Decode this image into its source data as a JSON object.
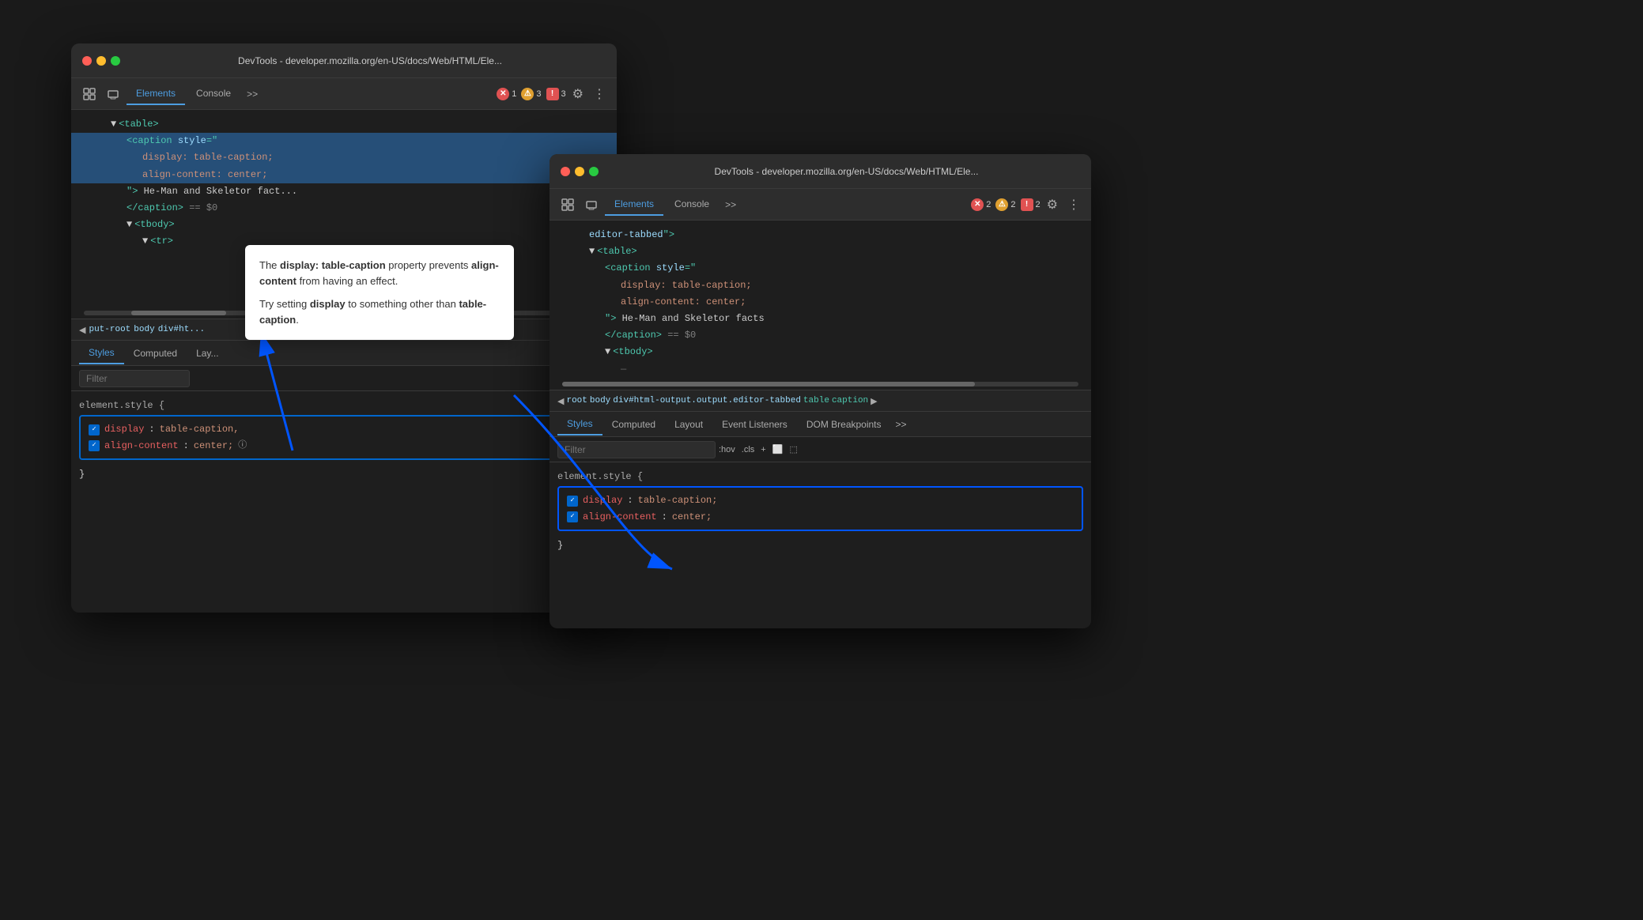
{
  "background": "#1a1a1a",
  "window_back": {
    "title": "DevTools - developer.mozilla.org/en-US/docs/Web/HTML/Ele...",
    "tabs": [
      "Elements",
      "Console"
    ],
    "tab_more": ">>",
    "active_tab": "Elements",
    "badges": [
      {
        "icon": "error",
        "count": "1",
        "type": "error"
      },
      {
        "icon": "warn",
        "count": "3",
        "type": "warn"
      },
      {
        "icon": "info",
        "count": "3",
        "type": "info"
      }
    ],
    "html_lines": [
      {
        "indent": 2,
        "content": "▼<table>",
        "selected": false
      },
      {
        "indent": 3,
        "content": "<caption style=\"",
        "selected": true
      },
      {
        "indent": 4,
        "content": "display: table-caption;",
        "selected": true
      },
      {
        "indent": 4,
        "content": "align-content: center;",
        "selected": true
      },
      {
        "indent": 3,
        "content": "\"> He-Man and Skeletor fact...",
        "selected": false
      },
      {
        "indent": 3,
        "content": "</caption> == $0",
        "selected": false
      },
      {
        "indent": 3,
        "content": "▼<tbody>",
        "selected": false
      },
      {
        "indent": 4,
        "content": "▼<tr>",
        "selected": false
      }
    ],
    "breadcrumb": [
      "◀",
      "put-root",
      "body",
      "div#ht..."
    ],
    "sub_tabs": [
      "Styles",
      "Computed",
      "Lay..."
    ],
    "active_sub_tab": "Styles",
    "filter_placeholder": "Filter",
    "css_rule": {
      "label": "element.style {",
      "props": [
        {
          "checked": true,
          "name": "display",
          "value": "table-caption,"
        },
        {
          "checked": true,
          "name": "align-content",
          "value": "center;",
          "has_info": true
        }
      ],
      "close": "}"
    }
  },
  "window_front": {
    "title": "DevTools - developer.mozilla.org/en-US/docs/Web/HTML/Ele...",
    "tabs": [
      "Elements",
      "Console"
    ],
    "tab_more": ">>",
    "active_tab": "Elements",
    "badges": [
      {
        "icon": "error",
        "count": "2",
        "type": "error"
      },
      {
        "icon": "warn",
        "count": "2",
        "type": "warn"
      },
      {
        "icon": "info",
        "count": "2",
        "type": "info"
      }
    ],
    "html_lines": [
      {
        "indent": 2,
        "content": "editor-tabbed\">",
        "selected": false
      },
      {
        "indent": 2,
        "content": "▼<table>",
        "selected": false
      },
      {
        "indent": 3,
        "content": "<caption style=\"",
        "selected": false
      },
      {
        "indent": 4,
        "content": "display: table-caption;",
        "selected": false
      },
      {
        "indent": 4,
        "content": "align-content: center;",
        "selected": false
      },
      {
        "indent": 3,
        "content": "\"> He-Man and Skeletor facts",
        "selected": false
      },
      {
        "indent": 3,
        "content": "</caption> == $0",
        "selected": false
      },
      {
        "indent": 3,
        "content": "▼<tbody>",
        "selected": false
      },
      {
        "indent": 4,
        "content": "—",
        "selected": false
      }
    ],
    "breadcrumb": [
      "◀",
      "root",
      "body",
      "div#html-output.output.editor-tabbed",
      "table",
      "caption",
      "▶"
    ],
    "sub_tabs": [
      "Styles",
      "Computed",
      "Layout",
      "Event Listeners",
      "DOM Breakpoints",
      ">>"
    ],
    "active_sub_tab": "Styles",
    "filter_placeholder": "Filter",
    "filter_controls": [
      ":hov",
      ".cls",
      "+",
      "⬜",
      "⬚"
    ],
    "css_rule": {
      "label": "element.style {",
      "props": [
        {
          "checked": true,
          "name": "display",
          "value": "table-caption;"
        },
        {
          "checked": true,
          "name": "align-content",
          "value": "center;"
        }
      ],
      "close": "}"
    }
  },
  "tooltip": {
    "line1_pre": "The ",
    "line1_bold": "display: table-caption",
    "line1_post": " property prevents ",
    "line1_bold2": "align-content",
    "line1_end": " from having an effect.",
    "line2_pre": "Try setting ",
    "line2_bold": "display",
    "line2_post": " to something other than ",
    "line2_bold2": "table-caption",
    "line2_end": "."
  }
}
